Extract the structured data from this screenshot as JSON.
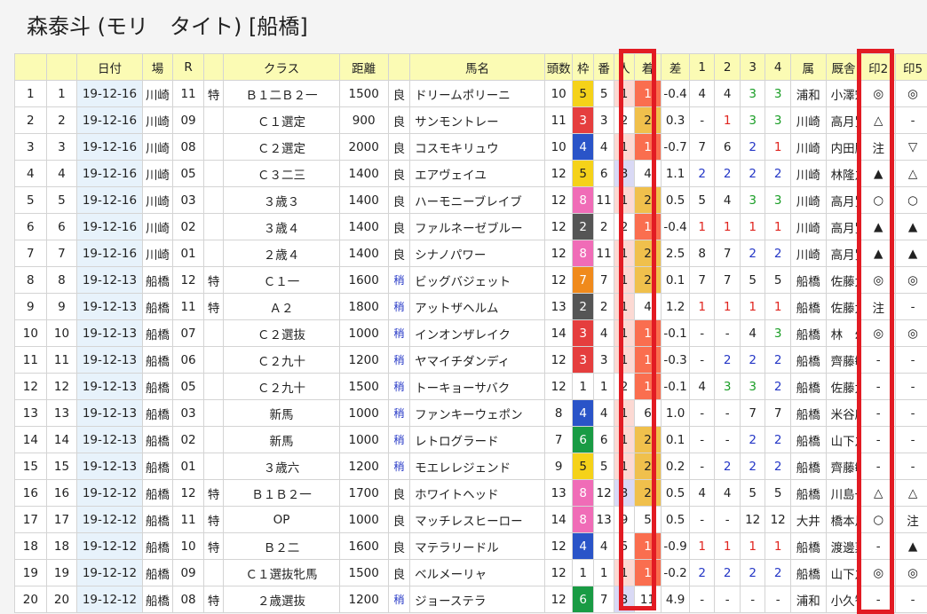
{
  "title": "森泰斗 (モリ　タイト) [船橋]",
  "headers": [
    "",
    "",
    "日付",
    "場",
    "R",
    "",
    "クラス",
    "距離",
    "",
    "馬名",
    "頭数",
    "枠",
    "番",
    "人",
    "着",
    "差",
    "1",
    "2",
    "3",
    "4",
    "属",
    "厩舎",
    "印2",
    "印5"
  ],
  "colors": {
    "waku": {
      "1": "#ffffff",
      "2": "#555555",
      "3": "#e53e3e",
      "4": "#2a54c8",
      "5": "#f5d219",
      "6": "#199b44",
      "7": "#f08a1c",
      "8": "#f06cb7"
    },
    "finish_first": "#fa6e4f",
    "finish_second": "#f0c04c",
    "ninki_first": "#fcd9d3",
    "ninki_third": "#d9d9f5",
    "header_bg": "#fbfbb4",
    "date_bg": "#e7f2fb",
    "highlight": "#e21b23"
  },
  "rows": [
    {
      "n1": "1",
      "n2": "1",
      "date": "19-12-16",
      "track": "川崎",
      "race": "11",
      "spec": "特",
      "cls": "Ｂ１二Ｂ２一",
      "dist": "1500",
      "cond": "良",
      "horse": "ドリームポリーニ",
      "heads": "10",
      "waku": "5",
      "ban": "5",
      "ninki": "1",
      "finish": "1",
      "diff": "-0.4",
      "c1": "4",
      "c2": "4",
      "c3": "3",
      "c4": "3",
      "aff": "浦和",
      "stable": "小澤宏",
      "m2": "◎",
      "m5": "◎"
    },
    {
      "n1": "2",
      "n2": "2",
      "date": "19-12-16",
      "track": "川崎",
      "race": "09",
      "spec": "",
      "cls": "Ｃ１選定",
      "dist": "900",
      "cond": "良",
      "horse": "サンモントレー",
      "heads": "11",
      "waku": "3",
      "ban": "3",
      "ninki": "2",
      "finish": "2",
      "diff": "0.3",
      "c1": "-",
      "c2": "1",
      "c3": "3",
      "c4": "3",
      "aff": "川崎",
      "stable": "高月賢",
      "m2": "△",
      "m5": "-"
    },
    {
      "n1": "3",
      "n2": "3",
      "date": "19-12-16",
      "track": "川崎",
      "race": "08",
      "spec": "",
      "cls": "Ｃ２選定",
      "dist": "2000",
      "cond": "良",
      "horse": "コスモキリュウ",
      "heads": "10",
      "waku": "4",
      "ban": "4",
      "ninki": "1",
      "finish": "1",
      "diff": "-0.7",
      "c1": "7",
      "c2": "6",
      "c3": "2",
      "c4": "1",
      "aff": "川崎",
      "stable": "内田勝",
      "m2": "注",
      "m5": "▽"
    },
    {
      "n1": "4",
      "n2": "4",
      "date": "19-12-16",
      "track": "川崎",
      "race": "05",
      "spec": "",
      "cls": "Ｃ３二三",
      "dist": "1400",
      "cond": "良",
      "horse": "エアヴェイユ",
      "heads": "12",
      "waku": "5",
      "ban": "6",
      "ninki": "3",
      "finish": "4",
      "diff": "1.1",
      "c1": "2",
      "c2": "2",
      "c3": "2",
      "c4": "2",
      "aff": "川崎",
      "stable": "林隆之",
      "m2": "▲",
      "m5": "△"
    },
    {
      "n1": "5",
      "n2": "5",
      "date": "19-12-16",
      "track": "川崎",
      "race": "03",
      "spec": "",
      "cls": "３歳３",
      "dist": "1400",
      "cond": "良",
      "horse": "ハーモニーブレイブ",
      "heads": "12",
      "waku": "8",
      "ban": "11",
      "ninki": "1",
      "finish": "2",
      "diff": "0.5",
      "c1": "5",
      "c2": "4",
      "c3": "3",
      "c4": "3",
      "aff": "川崎",
      "stable": "高月賢",
      "m2": "○",
      "m5": "○"
    },
    {
      "n1": "6",
      "n2": "6",
      "date": "19-12-16",
      "track": "川崎",
      "race": "02",
      "spec": "",
      "cls": "３歳４",
      "dist": "1400",
      "cond": "良",
      "horse": "ファルネーゼブルー",
      "heads": "12",
      "waku": "2",
      "ban": "2",
      "ninki": "2",
      "finish": "1",
      "diff": "-0.4",
      "c1": "1",
      "c2": "1",
      "c3": "1",
      "c4": "1",
      "aff": "川崎",
      "stable": "高月賢",
      "m2": "▲",
      "m5": "▲"
    },
    {
      "n1": "7",
      "n2": "7",
      "date": "19-12-16",
      "track": "川崎",
      "race": "01",
      "spec": "",
      "cls": "２歳４",
      "dist": "1400",
      "cond": "良",
      "horse": "シナノパワー",
      "heads": "12",
      "waku": "8",
      "ban": "11",
      "ninki": "1",
      "finish": "2",
      "diff": "2.5",
      "c1": "8",
      "c2": "7",
      "c3": "2",
      "c4": "2",
      "aff": "川崎",
      "stable": "高月賢",
      "m2": "▲",
      "m5": "▲"
    },
    {
      "n1": "8",
      "n2": "8",
      "date": "19-12-13",
      "track": "船橋",
      "race": "12",
      "spec": "特",
      "cls": "Ｃ１一",
      "dist": "1600",
      "cond": "稍",
      "horse": "ビッグバジェット",
      "heads": "12",
      "waku": "7",
      "ban": "7",
      "ninki": "1",
      "finish": "2",
      "diff": "0.1",
      "c1": "7",
      "c2": "7",
      "c3": "5",
      "c4": "5",
      "aff": "船橋",
      "stable": "佐藤太",
      "m2": "◎",
      "m5": "◎"
    },
    {
      "n1": "9",
      "n2": "9",
      "date": "19-12-13",
      "track": "船橋",
      "race": "11",
      "spec": "特",
      "cls": "Ａ２",
      "dist": "1800",
      "cond": "稍",
      "horse": "アットザヘルム",
      "heads": "13",
      "waku": "2",
      "ban": "2",
      "ninki": "1",
      "finish": "4",
      "diff": "1.2",
      "c1": "1",
      "c2": "1",
      "c3": "1",
      "c4": "1",
      "aff": "船橋",
      "stable": "佐藤太",
      "m2": "注",
      "m5": "-"
    },
    {
      "n1": "10",
      "n2": "10",
      "date": "19-12-13",
      "track": "船橋",
      "race": "07",
      "spec": "",
      "cls": "Ｃ２選抜",
      "dist": "1000",
      "cond": "稍",
      "horse": "インオンザレイク",
      "heads": "14",
      "waku": "3",
      "ban": "4",
      "ninki": "1",
      "finish": "1",
      "diff": "-0.1",
      "c1": "-",
      "c2": "-",
      "c3": "4",
      "c4": "3",
      "aff": "船橋",
      "stable": "林　幻",
      "m2": "◎",
      "m5": "◎"
    },
    {
      "n1": "11",
      "n2": "11",
      "date": "19-12-13",
      "track": "船橋",
      "race": "06",
      "spec": "",
      "cls": "Ｃ２九十",
      "dist": "1200",
      "cond": "稍",
      "horse": "ヤマイチダンディ",
      "heads": "12",
      "waku": "3",
      "ban": "3",
      "ninki": "1",
      "finish": "1",
      "diff": "-0.3",
      "c1": "-",
      "c2": "2",
      "c3": "2",
      "c4": "2",
      "aff": "船橋",
      "stable": "齊藤敏",
      "m2": "-",
      "m5": "-"
    },
    {
      "n1": "12",
      "n2": "12",
      "date": "19-12-13",
      "track": "船橋",
      "race": "05",
      "spec": "",
      "cls": "Ｃ２九十",
      "dist": "1500",
      "cond": "稍",
      "horse": "トーキョーサバク",
      "heads": "12",
      "waku": "1",
      "ban": "1",
      "ninki": "2",
      "finish": "1",
      "diff": "-0.1",
      "c1": "4",
      "c2": "3",
      "c3": "3",
      "c4": "2",
      "aff": "船橋",
      "stable": "佐藤太",
      "m2": "-",
      "m5": "-"
    },
    {
      "n1": "13",
      "n2": "13",
      "date": "19-12-13",
      "track": "船橋",
      "race": "03",
      "spec": "",
      "cls": "新馬",
      "dist": "1000",
      "cond": "稍",
      "horse": "ファンキーウェポン",
      "heads": "8",
      "waku": "4",
      "ban": "4",
      "ninki": "1",
      "finish": "6",
      "diff": "1.0",
      "c1": "-",
      "c2": "-",
      "c3": "7",
      "c4": "7",
      "aff": "船橋",
      "stable": "米谷康",
      "m2": "-",
      "m5": "-"
    },
    {
      "n1": "14",
      "n2": "14",
      "date": "19-12-13",
      "track": "船橋",
      "race": "02",
      "spec": "",
      "cls": "新馬",
      "dist": "1000",
      "cond": "稍",
      "horse": "レトログラード",
      "heads": "7",
      "waku": "6",
      "ban": "6",
      "ninki": "1",
      "finish": "2",
      "diff": "0.1",
      "c1": "-",
      "c2": "-",
      "c3": "2",
      "c4": "2",
      "aff": "船橋",
      "stable": "山下之",
      "m2": "-",
      "m5": "-"
    },
    {
      "n1": "15",
      "n2": "15",
      "date": "19-12-13",
      "track": "船橋",
      "race": "01",
      "spec": "",
      "cls": "３歳六",
      "dist": "1200",
      "cond": "稍",
      "horse": "モエレレジェンド",
      "heads": "9",
      "waku": "5",
      "ban": "5",
      "ninki": "1",
      "finish": "2",
      "diff": "0.2",
      "c1": "-",
      "c2": "2",
      "c3": "2",
      "c4": "2",
      "aff": "船橋",
      "stable": "齊藤敏",
      "m2": "-",
      "m5": "-"
    },
    {
      "n1": "16",
      "n2": "16",
      "date": "19-12-12",
      "track": "船橋",
      "race": "12",
      "spec": "特",
      "cls": "Ｂ１Ｂ２一",
      "dist": "1700",
      "cond": "良",
      "horse": "ホワイトヘッド",
      "heads": "13",
      "waku": "8",
      "ban": "12",
      "ninki": "3",
      "finish": "2",
      "diff": "0.5",
      "c1": "4",
      "c2": "4",
      "c3": "5",
      "c4": "5",
      "aff": "船橋",
      "stable": "川島一",
      "m2": "△",
      "m5": "△"
    },
    {
      "n1": "17",
      "n2": "17",
      "date": "19-12-12",
      "track": "船橋",
      "race": "11",
      "spec": "特",
      "cls": "OP",
      "dist": "1000",
      "cond": "良",
      "horse": "マッチレスヒーロー",
      "heads": "14",
      "waku": "8",
      "ban": "13",
      "ninki": "9",
      "finish": "5",
      "diff": "0.5",
      "c1": "-",
      "c2": "-",
      "c3": "12",
      "c4": "12",
      "aff": "大井",
      "stable": "橋本馬",
      "m2": "○",
      "m5": "注"
    },
    {
      "n1": "18",
      "n2": "18",
      "date": "19-12-12",
      "track": "船橋",
      "race": "10",
      "spec": "特",
      "cls": "Ｂ２二",
      "dist": "1600",
      "cond": "良",
      "horse": "マテラリードル",
      "heads": "12",
      "waku": "4",
      "ban": "4",
      "ninki": "5",
      "finish": "1",
      "diff": "-0.9",
      "c1": "1",
      "c2": "1",
      "c3": "1",
      "c4": "1",
      "aff": "船橋",
      "stable": "渡邊菓",
      "m2": "-",
      "m5": "▲"
    },
    {
      "n1": "19",
      "n2": "19",
      "date": "19-12-12",
      "track": "船橋",
      "race": "09",
      "spec": "",
      "cls": "Ｃ１選抜牝馬",
      "dist": "1500",
      "cond": "良",
      "horse": "ベルメーリャ",
      "heads": "12",
      "waku": "1",
      "ban": "1",
      "ninki": "1",
      "finish": "1",
      "diff": "-0.2",
      "c1": "2",
      "c2": "2",
      "c3": "2",
      "c4": "2",
      "aff": "船橋",
      "stable": "山下之",
      "m2": "◎",
      "m5": "◎"
    },
    {
      "n1": "20",
      "n2": "20",
      "date": "19-12-12",
      "track": "船橋",
      "race": "08",
      "spec": "特",
      "cls": "２歳選抜",
      "dist": "1200",
      "cond": "稍",
      "horse": "ジョーステラ",
      "heads": "12",
      "waku": "6",
      "ban": "7",
      "ninki": "3",
      "finish": "11",
      "diff": "4.9",
      "c1": "-",
      "c2": "-",
      "c3": "-",
      "c4": "-",
      "aff": "浦和",
      "stable": "小久智",
      "m2": "-",
      "m5": "-"
    }
  ]
}
